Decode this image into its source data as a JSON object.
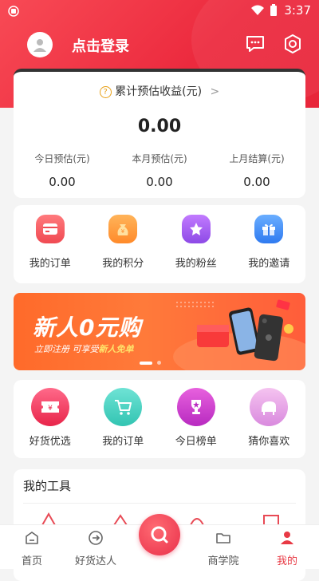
{
  "status": {
    "time": "3:37"
  },
  "header": {
    "login_text": "点击登录"
  },
  "earnings": {
    "title": "累计预估收益(元)",
    "total": "0.00",
    "columns": [
      {
        "label": "今日预估(元)",
        "value": "0.00"
      },
      {
        "label": "本月预估(元)",
        "value": "0.00"
      },
      {
        "label": "上月结算(元)",
        "value": "0.00"
      }
    ]
  },
  "quick_menu": [
    {
      "label": "我的订单",
      "icon": "order-card-icon",
      "color": "#ff5a5f"
    },
    {
      "label": "我的积分",
      "icon": "points-bag-icon",
      "color": "#ff9a3c"
    },
    {
      "label": "我的粉丝",
      "icon": "star-fans-icon",
      "color": "#a45cf0"
    },
    {
      "label": "我的邀请",
      "icon": "gift-invite-icon",
      "color": "#3d8bff"
    }
  ],
  "banner": {
    "title": "新人0元购",
    "subtitle_prefix": "立即注册  可享受",
    "subtitle_highlight": "新人免单"
  },
  "shop_menu": [
    {
      "label": "好货优选",
      "icon": "coupon-icon",
      "color": "#f0355a"
    },
    {
      "label": "我的订单",
      "icon": "cart-icon",
      "color": "#3fcfc0"
    },
    {
      "label": "今日榜单",
      "icon": "trophy-icon",
      "color": "#d83ad0"
    },
    {
      "label": "猜你喜欢",
      "icon": "piano-icon",
      "color": "#e39ae6"
    }
  ],
  "tools": {
    "title": "我的工具"
  },
  "tabbar": {
    "items": [
      {
        "label": "首页",
        "icon": "home-icon"
      },
      {
        "label": "好货达人",
        "icon": "arrow-circle-icon"
      },
      {
        "label": "",
        "icon": "search-icon"
      },
      {
        "label": "商学院",
        "icon": "folder-icon"
      },
      {
        "label": "我的",
        "icon": "person-icon"
      }
    ],
    "active_color": "#e83a45"
  },
  "colors": {
    "brand": "#ec2a3e"
  }
}
